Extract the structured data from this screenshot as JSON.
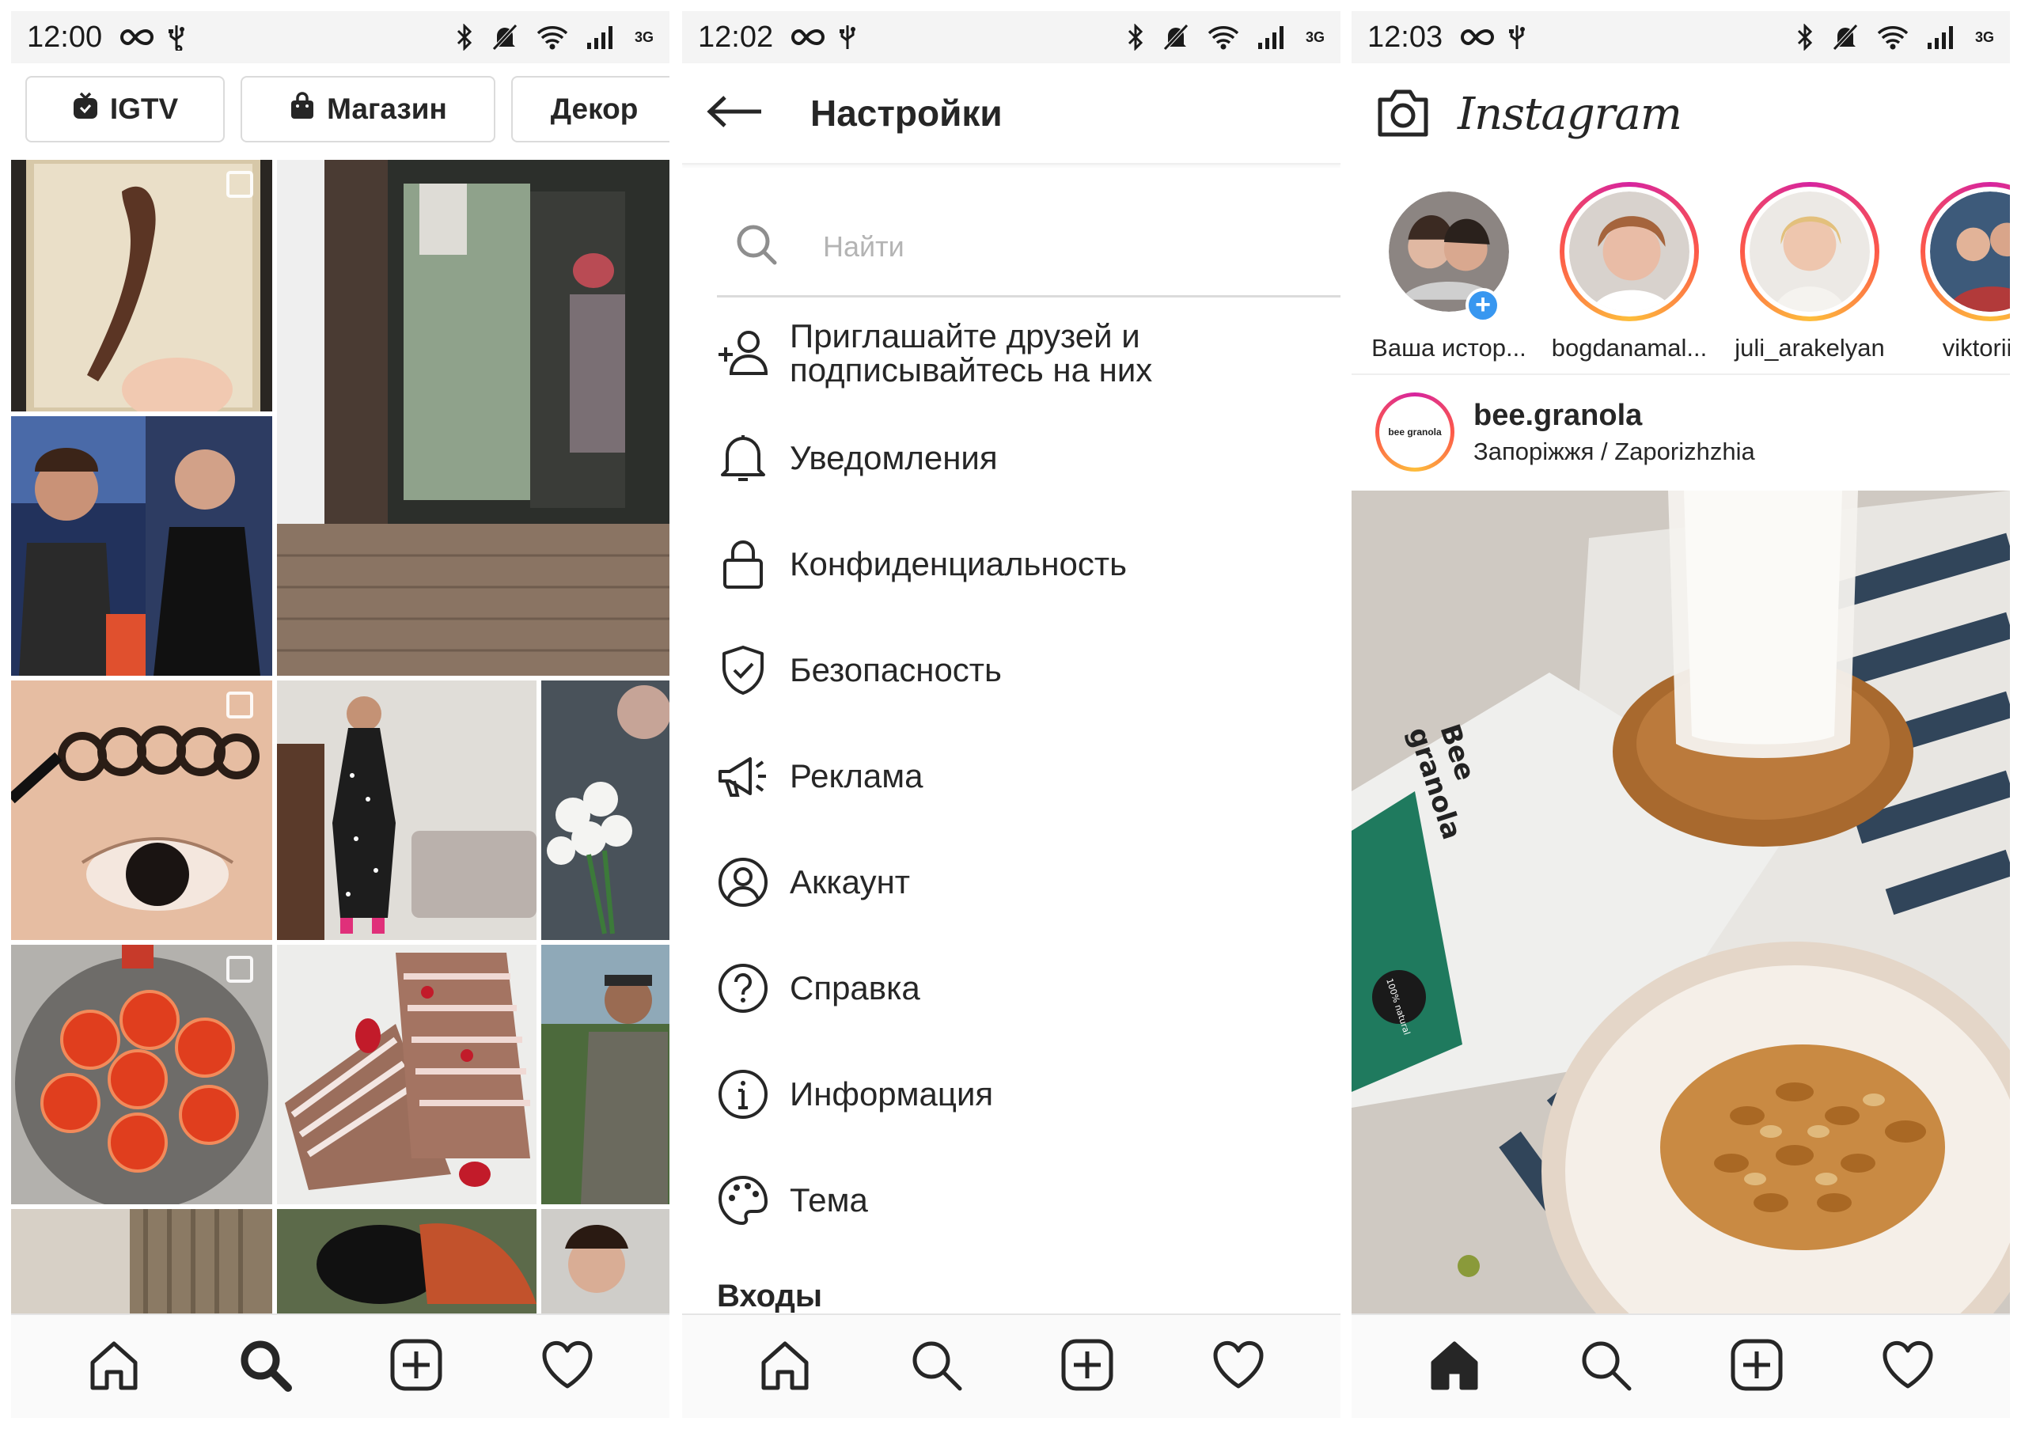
{
  "colors": {
    "story_ring_start": "#d6249f",
    "story_ring_end": "#fdbe3b",
    "add_story_blue": "#3897f0",
    "text": "#262626",
    "placeholder": "#b4b4b4"
  },
  "screens": [
    {
      "status": {
        "time": "12:00",
        "network": "3G"
      },
      "explore": {
        "chips": [
          {
            "label": "IGTV",
            "icon": "igtv-icon"
          },
          {
            "label": "Магазин",
            "icon": "shopping-bag-icon"
          },
          {
            "label": "Декор",
            "icon": ""
          }
        ]
      },
      "nav_active": "search"
    },
    {
      "status": {
        "time": "12:02",
        "network": "3G"
      },
      "settings": {
        "title": "Настройки",
        "search_placeholder": "Найти",
        "items": [
          {
            "label_line1": "Приглашайте друзей и",
            "label_line2": "подписывайтесь на них",
            "icon": "add-person-icon"
          },
          {
            "label": "Уведомления",
            "icon": "bell-icon"
          },
          {
            "label": "Конфиденциальность",
            "icon": "lock-icon"
          },
          {
            "label": "Безопасность",
            "icon": "shield-check-icon"
          },
          {
            "label": "Реклама",
            "icon": "megaphone-icon"
          },
          {
            "label": "Аккаунт",
            "icon": "account-circle-icon"
          },
          {
            "label": "Справка",
            "icon": "help-icon"
          },
          {
            "label": "Информация",
            "icon": "info-icon"
          },
          {
            "label": "Тема",
            "icon": "palette-icon"
          }
        ],
        "section_title": "Входы"
      },
      "nav_active": "none"
    },
    {
      "status": {
        "time": "12:03",
        "network": "3G"
      },
      "feed": {
        "logo": "Instagram",
        "stories": [
          {
            "name": "Ваша истор..."
          },
          {
            "name": "bogdanamal..."
          },
          {
            "name": "juli_arakelyan"
          },
          {
            "name": "viktoriiatl"
          }
        ],
        "post": {
          "username": "bee.granola",
          "location": "Запоріжжя / Zaporizhzhia",
          "avatar_text": "bee granola",
          "package_text_line1": "Bee",
          "package_text_line2": "granola",
          "badge_text": "100% natural"
        }
      },
      "nav_active": "home"
    }
  ]
}
